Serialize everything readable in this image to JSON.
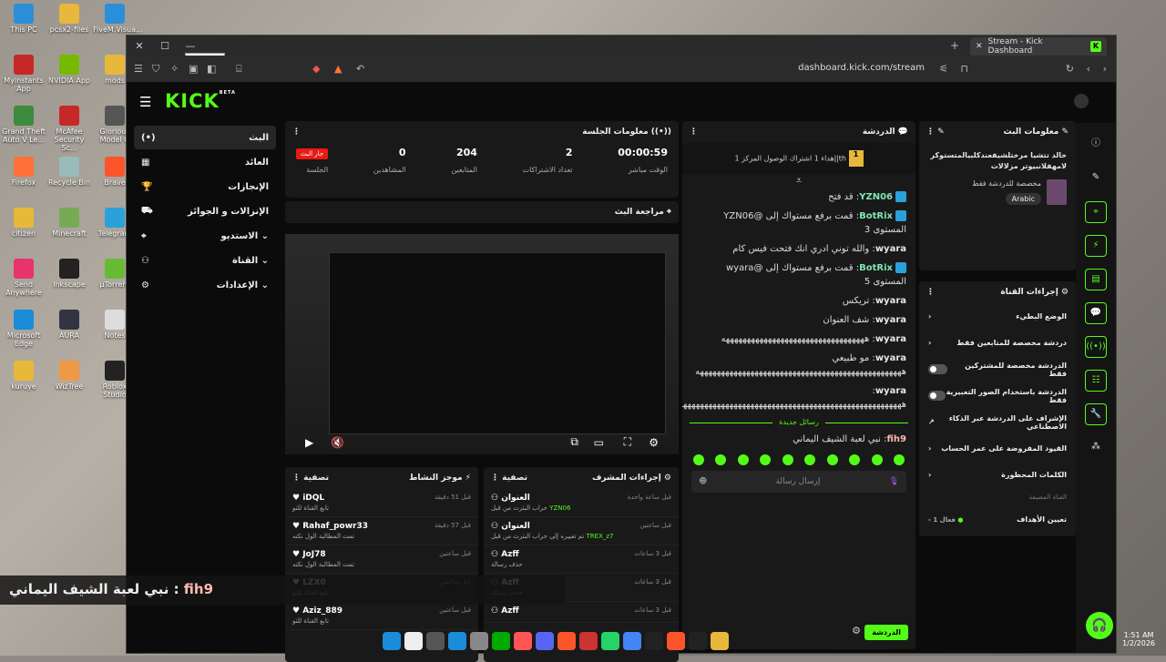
{
  "desktop": {
    "icons": [
      {
        "label": "This PC",
        "color": "#2a8fd8"
      },
      {
        "label": "pcsx2-files",
        "color": "#e7b83a"
      },
      {
        "label": "FiveM.Visua...",
        "color": "#2a8fd8"
      },
      {
        "label": "Myinstants App",
        "color": "#c62828"
      },
      {
        "label": "NVIDIA App",
        "color": "#76b900"
      },
      {
        "label": "mods",
        "color": "#e7b83a"
      },
      {
        "label": "Grand Theft Auto V Le...",
        "color": "#3d8b3d"
      },
      {
        "label": "McAfee Security Sc...",
        "color": "#c62828"
      },
      {
        "label": "Glorious Model O",
        "color": "#555"
      },
      {
        "label": "Firefox",
        "color": "#ff7139"
      },
      {
        "label": "Recycle Bin",
        "color": "#9bb"
      },
      {
        "label": "Brave",
        "color": "#fb542b"
      },
      {
        "label": "citizen",
        "color": "#e7b83a"
      },
      {
        "label": "Minecraft",
        "color": "#7a5"
      },
      {
        "label": "Telegram",
        "color": "#2aa1da"
      },
      {
        "label": "Send Anywhere",
        "color": "#e8336d"
      },
      {
        "label": "Inkscape",
        "color": "#222"
      },
      {
        "label": "µTorrent",
        "color": "#6b3"
      },
      {
        "label": "Microsoft Edge",
        "color": "#1a8cd8"
      },
      {
        "label": "AURA",
        "color": "#334"
      },
      {
        "label": "Notes",
        "color": "#ddd"
      },
      {
        "label": "kuruye",
        "color": "#e7b83a"
      },
      {
        "label": "WizTree",
        "color": "#e94"
      },
      {
        "label": "Roblox Studio",
        "color": "#222"
      }
    ]
  },
  "browser": {
    "tab_title": "Stream - Kick Dashboard",
    "tooltip": "Minimize",
    "url": "dashboard.kick.com/stream"
  },
  "logo": "KICK",
  "logo_beta": "BETA",
  "leftnav": [
    {
      "label": "البث",
      "icon": "(•)"
    },
    {
      "label": "العائد",
      "icon": "▦"
    },
    {
      "label": "الإنجازات",
      "icon": "🏆"
    },
    {
      "label": "الإنزالات و الجوائز",
      "icon": "⛟"
    },
    {
      "label": "الاستديو",
      "icon": "⌖"
    },
    {
      "label": "القناة",
      "icon": "⚇"
    },
    {
      "label": "الإعدادات",
      "icon": "⚙"
    }
  ],
  "session": {
    "title": "معلومات الجلسة",
    "live_label": "جار البث",
    "session_label": "الجلسة",
    "stats": [
      {
        "value": "00:00:59",
        "label": "الوقت مباشر"
      },
      {
        "value": "2",
        "label": "تعداد الاشتراكات"
      },
      {
        "value": "204",
        "label": "المتابعين"
      },
      {
        "value": "0",
        "label": "المشاهدين"
      }
    ]
  },
  "preview": {
    "title": "مراجعة البث"
  },
  "activity": {
    "title": "موجز النشاط",
    "filter": "تصفية",
    "items": [
      {
        "name": "iDQL",
        "sub": "تابع القناة للتو",
        "time": "قبل 51 دقيقة"
      },
      {
        "name": "Rahaf_powr33",
        "sub": "تمت المطالبة الول نكته",
        "time": "قبل 57 دقيقة"
      },
      {
        "name": "JoJ78",
        "sub": "تمت المطالبة الول نكته",
        "time": "قبل ساعتين"
      },
      {
        "name": "LZX0",
        "sub": "تابع القناة للتو",
        "time": "قبل ساعتين"
      },
      {
        "name": "Aziz_889",
        "sub": "تابع القناة للتو",
        "time": "قبل ساعتين"
      }
    ]
  },
  "modactions": {
    "title": "إجراءات المشرف",
    "filter": "تصفية",
    "items": [
      {
        "name": "العنوان",
        "user": "YZN06",
        "sub": "حراب البثرث من قبل",
        "time": "قبل ساعة واحدة"
      },
      {
        "name": "العنوان",
        "user": "TREX_z7",
        "sub": "تم تغييره إلى حراب البثرث من قبل",
        "time": "قبل ساعتين"
      },
      {
        "name": "Azff",
        "sub": "حذف رسالة",
        "time": "قبل 3 ساعات"
      },
      {
        "name": "Azff",
        "sub": "حذف رسالة",
        "time": "قبل 3 ساعات"
      },
      {
        "name": "Azff",
        "sub": "",
        "time": "قبل 3 ساعات"
      }
    ]
  },
  "chat": {
    "title": "الدردشة",
    "pinned": "إهداء 1 اشتراك الوصول المركز 1|th",
    "new_messages": "رسائل جديدة",
    "input_placeholder": "إرسال رسالة",
    "send_label": "الدردشة",
    "messages": [
      {
        "user": "YZN06",
        "text": "قد فتح",
        "green": true
      },
      {
        "user": "BotRix",
        "text": "قمت برفع مستواك إلى @YZN06 المستوى 3",
        "green": true
      },
      {
        "user": "wyara",
        "text": "والله توني ادري انك فتحت فيس كام",
        "green": false
      },
      {
        "user": "BotRix",
        "text": "قمت برفع مستواك إلى @wyara المستوى 5",
        "green": true
      },
      {
        "user": "wyara",
        "text": "تريكس",
        "green": false
      },
      {
        "user": "wyara",
        "text": "شف العنوان",
        "green": false
      },
      {
        "user": "wyara",
        "text": "ههههههههههههههههههههههههههههههههههه",
        "green": false
      },
      {
        "user": "wyara",
        "text": "مو طبيعي هههههههههههههههههههههههههههههههههههههههههههههههههه",
        "green": false
      },
      {
        "user": "wyara",
        "text": "هههههههههههههههههههههههههههههههههههههههههههههههههههههه",
        "green": false
      }
    ],
    "last": {
      "user": "fih9",
      "text": "نبي لعبة الشيف اليماني"
    }
  },
  "streaminfo": {
    "title": "معلومات البث",
    "stream_title": "خالد تتشيا مرختلشيفعندكلبيالمتستوكر لامهفلانبيوتر مزلالات",
    "category": "مخصصة للدردشة فقط",
    "tag": "Arabic"
  },
  "channelactions": {
    "title": "إجراءات القناة",
    "rows": [
      {
        "label": "الوضع البطيء",
        "type": "arrow"
      },
      {
        "label": "دردشة مخصصة للمتابعين فقط",
        "type": "arrow"
      },
      {
        "label": "الدردشة مخصصة للمشتركين فقط",
        "type": "toggle"
      },
      {
        "label": "الدردشة باستخدام الصور التعبيرية فقط",
        "type": "toggle"
      },
      {
        "label": "الإشراف على الدردشة عبر الذكاء الاصطناعي",
        "type": "link"
      },
      {
        "label": "القيود المفروضة على عمر الحساب",
        "type": "arrow"
      },
      {
        "label": "الكلمات المحظورة",
        "type": "arrow"
      }
    ],
    "section": "القناة المضيفة",
    "goals_label": "تعيين الأهداف",
    "goals_value": "فعال 1"
  },
  "overlay": {
    "user": "fih9",
    "text": "نبي لعبة الشيف اليماني"
  },
  "clock": {
    "time": "1:51 AM",
    "date": "1/2/2026"
  },
  "colors": {
    "kick_green": "#53fc18",
    "live_red": "#e91916"
  }
}
